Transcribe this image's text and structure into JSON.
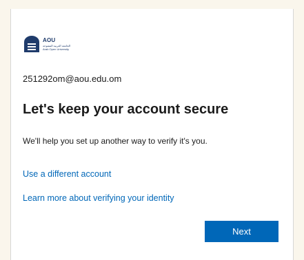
{
  "logo": {
    "name": "AOU",
    "arabic": "الجامعة العربية المفتوحة",
    "english": "Arab Open University",
    "icon": "aou-logo-icon",
    "color": "#1f3b6b"
  },
  "account": {
    "email": "251292om@aou.edu.om"
  },
  "main": {
    "title": "Let's keep your account secure",
    "description": "We'll help you set up another way to verify it's you."
  },
  "links": {
    "different_account": "Use a different account",
    "learn_more": "Learn more about verifying your identity"
  },
  "actions": {
    "next_label": "Next"
  },
  "colors": {
    "accent": "#0067b8",
    "background": "#faf6ec",
    "card": "#ffffff",
    "text": "#1b1b1b"
  }
}
